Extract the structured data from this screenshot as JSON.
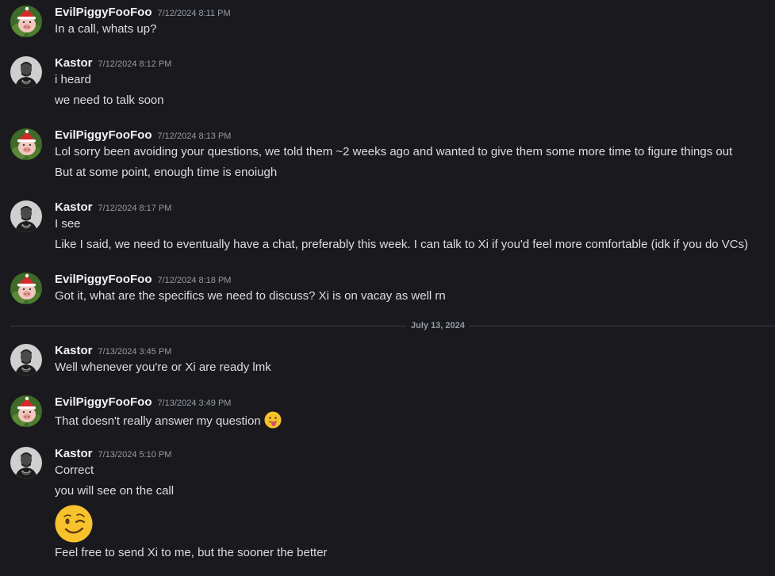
{
  "messages": [
    {
      "author": "EvilPiggyFooFoo",
      "timestamp": "7/12/2024 8:11 PM",
      "avatar": "pig-santa-hat-avatar",
      "lines": [
        "In a call, whats up?"
      ]
    },
    {
      "author": "Kastor",
      "timestamp": "7/12/2024 8:12 PM",
      "avatar": "man-portrait-avatar",
      "lines": [
        "i heard",
        "we need to talk soon"
      ]
    },
    {
      "author": "EvilPiggyFooFoo",
      "timestamp": "7/12/2024 8:13 PM",
      "avatar": "pig-santa-hat-avatar",
      "lines": [
        "Lol sorry been avoiding your questions, we told them ~2 weeks ago and wanted to give them some more time to figure things out",
        "But at some point, enough time is enoiugh"
      ]
    },
    {
      "author": "Kastor",
      "timestamp": "7/12/2024 8:17 PM",
      "avatar": "man-portrait-avatar",
      "lines": [
        "I see",
        "Like I said, we need to eventually have a chat, preferably this week. I can talk to Xi if you'd feel more comfortable (idk if you do VCs)"
      ]
    },
    {
      "author": "EvilPiggyFooFoo",
      "timestamp": "7/12/2024 8:18 PM",
      "avatar": "pig-santa-hat-avatar",
      "lines": [
        "Got it, what are the specifics we need to discuss? Xi is on vacay as well rn"
      ]
    },
    {
      "author": "Kastor",
      "timestamp": "7/13/2024 3:45 PM",
      "avatar": "man-portrait-avatar",
      "lines": [
        "Well whenever you're or Xi are ready lmk"
      ]
    },
    {
      "author": "EvilPiggyFooFoo",
      "timestamp": "7/13/2024 3:49 PM",
      "avatar": "pig-santa-hat-avatar",
      "lines": [
        "That doesn't really answer my question"
      ],
      "emoji": "tongue-out-emoji"
    },
    {
      "author": "Kastor",
      "timestamp": "7/13/2024 5:10 PM",
      "avatar": "man-portrait-avatar",
      "lines": [
        "Correct",
        "you will see on the call",
        "Feel free to send Xi to me, but the sooner the better"
      ],
      "big_emoji": "winking-face-emoji"
    }
  ],
  "date_divider": "July 13, 2024",
  "colors": {
    "background": "#1a1a1e",
    "author": "#f2f3f5",
    "text": "#dbdee1",
    "muted": "#949ba4",
    "divider": "#3b3d44"
  }
}
